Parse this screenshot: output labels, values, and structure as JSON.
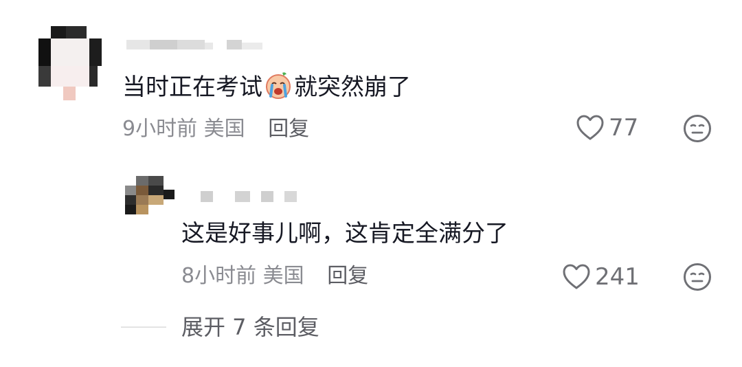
{
  "comments": [
    {
      "text_before_emoji": "当时正在考试",
      "emoji": "crying-face-emoji",
      "text_after_emoji": "就突然崩了",
      "time": "9小时前",
      "location": "美国",
      "reply_label": "回复",
      "likes": "77"
    }
  ],
  "replies": [
    {
      "text": "这是好事儿啊，这肯定全满分了",
      "time": "8小时前",
      "location": "美国",
      "reply_label": "回复",
      "likes": "241"
    }
  ],
  "expand_label": "展开 7 条回复",
  "icons": {
    "like": "heart-outline-icon",
    "dislike": "neutral-face-icon"
  },
  "colors": {
    "text_primary": "#161823",
    "text_secondary": "#8a8b91",
    "icon": "#6f7075"
  }
}
